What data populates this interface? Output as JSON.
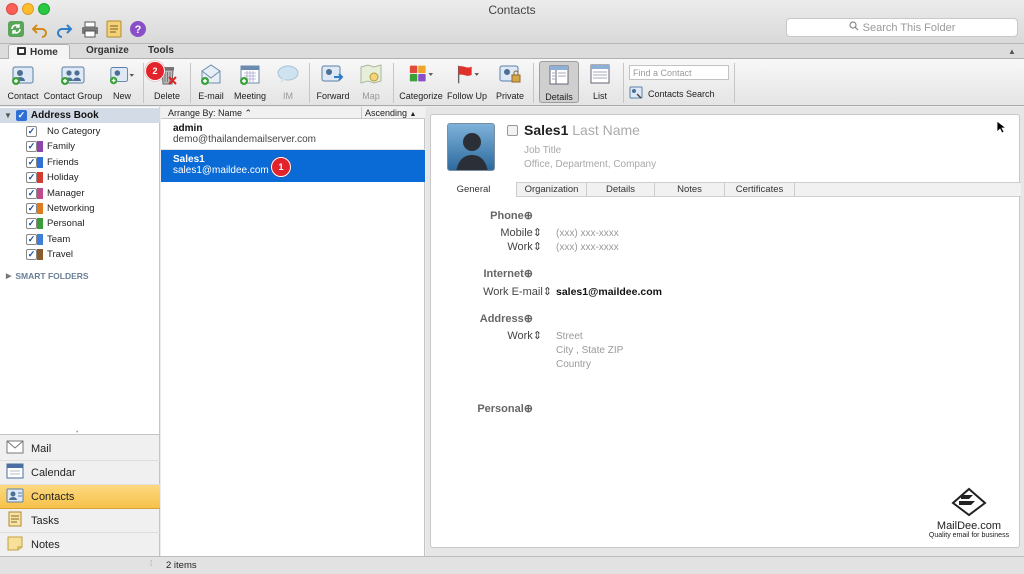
{
  "window": {
    "title": "Contacts"
  },
  "search": {
    "placeholder": "Search This Folder"
  },
  "tabs": [
    "Home",
    "Organize",
    "Tools"
  ],
  "ribbon": {
    "buttons": [
      "Contact",
      "Contact Group",
      "New",
      "Delete",
      "E-mail",
      "Meeting",
      "IM",
      "Forward",
      "Map",
      "Categorize",
      "Follow Up",
      "Private",
      "Details",
      "List"
    ],
    "find_placeholder": "Find a Contact",
    "contacts_search": "Contacts Search"
  },
  "sidebar": {
    "address_book": "Address Book",
    "categories": [
      {
        "name": "No Category",
        "color": "#ffffff"
      },
      {
        "name": "Family",
        "color": "#8e44ad"
      },
      {
        "name": "Friends",
        "color": "#2f6fd6"
      },
      {
        "name": "Holiday",
        "color": "#d63a2f"
      },
      {
        "name": "Manager",
        "color": "#c04a8c"
      },
      {
        "name": "Networking",
        "color": "#e07a1f"
      },
      {
        "name": "Personal",
        "color": "#3a9b3a"
      },
      {
        "name": "Team",
        "color": "#3f7fd8"
      },
      {
        "name": "Travel",
        "color": "#8a5a2b"
      }
    ],
    "smart_folders": "SMART FOLDERS"
  },
  "nav": [
    "Mail",
    "Calendar",
    "Contacts",
    "Tasks",
    "Notes"
  ],
  "list": {
    "arrange_by": "Arrange By: Name",
    "order": "Ascending",
    "contacts": [
      {
        "name": "admin",
        "email": "demo@thailandemailserver.com"
      },
      {
        "name": "Sales1",
        "email": "sales1@maildee.com"
      }
    ]
  },
  "badges": {
    "list": "1",
    "delete": "2"
  },
  "detail": {
    "first_name": "Sales1",
    "last_name": "Last Name",
    "job_title": "Job Title",
    "office": "Office",
    "department": "Department",
    "company": "Company",
    "tabs": [
      "General",
      "Organization",
      "Details",
      "Notes",
      "Certificates"
    ],
    "phone_label": "Phone",
    "mobile_label": "Mobile",
    "work_label": "Work",
    "phone_placeholder": "(xxx) xxx-xxxx",
    "internet_label": "Internet",
    "work_email_label": "Work E-mail",
    "work_email": "sales1@maildee.com",
    "address_label": "Address",
    "address_work_label": "Work",
    "street": "Street",
    "city": "City",
    "state_zip": "State ZIP",
    "country": "Country",
    "personal_label": "Personal"
  },
  "logo": {
    "name": "MailDee.com",
    "tagline": "Quality email for business"
  },
  "status": {
    "items": "2 items"
  }
}
